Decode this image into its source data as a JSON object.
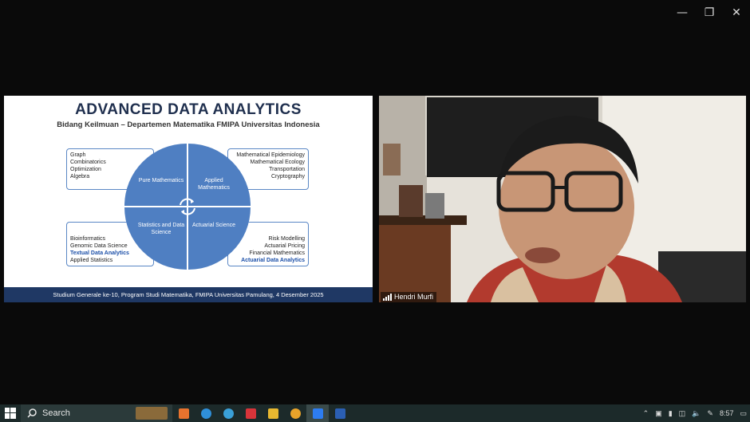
{
  "window_controls": {
    "minimize": "—",
    "restore": "❐",
    "close": "✕"
  },
  "slide": {
    "title": "ADVANCED DATA ANALYTICS",
    "subtitle": "Bidang Keilmuan – Departemen Matematika FMIPA Universitas Indonesia",
    "quadrants": {
      "pure": "Pure Mathematics",
      "applied": "Applied Mathematics",
      "stats": "Statistics and Data Science",
      "actuarial": "Actuarial Science"
    },
    "boxes": {
      "top_left": [
        "Graph",
        "Combinatorics",
        "Optimization",
        "Algebra"
      ],
      "top_right": [
        "Mathematical Epidemiology",
        "Mathematical Ecology",
        "Transportation",
        "Cryptography"
      ],
      "bottom_left": [
        "Bioinformatics",
        "Genomic Data Science",
        "Textual Data Analytics",
        "Applied Statistics"
      ],
      "bottom_right": [
        "Risk Modelling",
        "Actuarial Pricing",
        "Financial Mathematics",
        "Actuarial Data Analytics"
      ]
    },
    "footer": "Studium Generale ke-10, Program Studi Matematika, FMIPA Universitas Pamulang, 4 Desember 2025"
  },
  "video": {
    "participant_name": "Hendri Murfi"
  },
  "taskbar": {
    "search_placeholder": "Search",
    "clock": "8:57",
    "colors": {
      "bg": "#1c2a2a",
      "accent": "#4f7fc2"
    }
  }
}
